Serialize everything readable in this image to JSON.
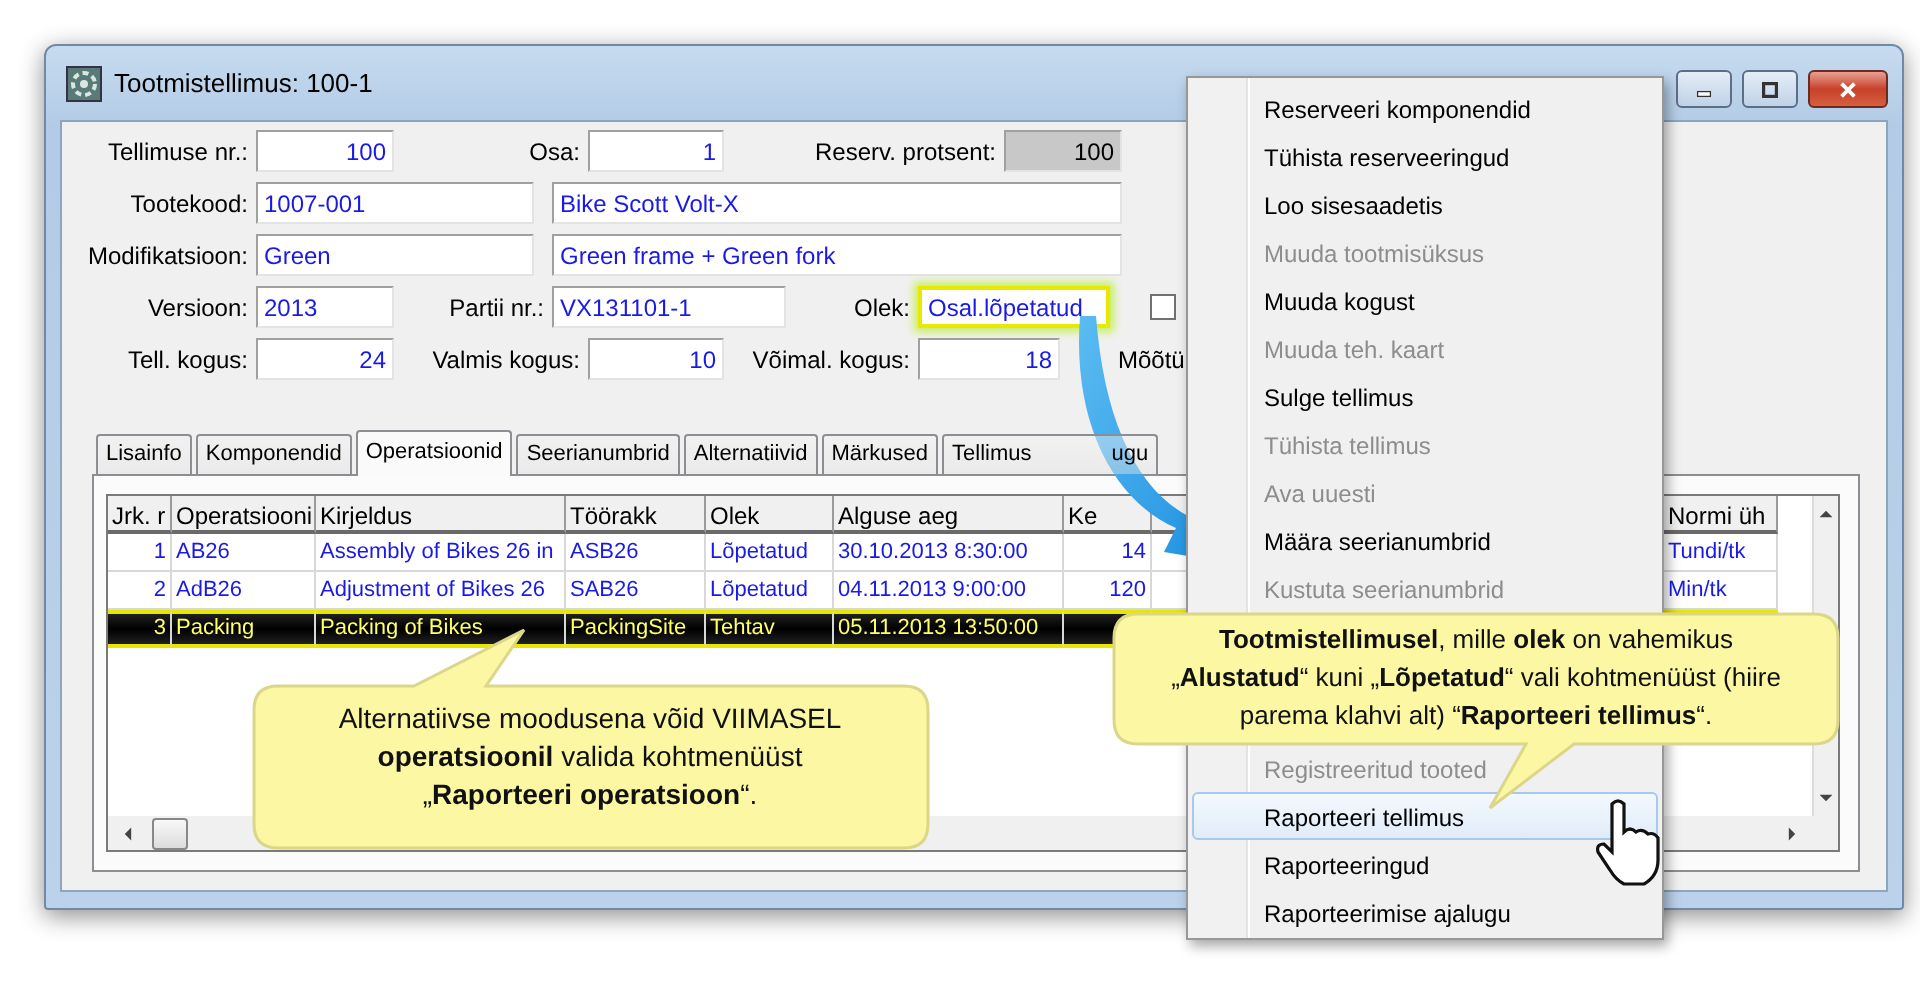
{
  "window": {
    "title": "Tootmistellimus: 100-1"
  },
  "header": {
    "order_no": {
      "label": "Tellimuse nr.:",
      "value": "100"
    },
    "part": {
      "label": "Osa:",
      "value": "1"
    },
    "reserve_percent": {
      "label": "Reserv. protsent:",
      "value": "100",
      "disabled": true
    },
    "product_code": {
      "label": "Tootekood:",
      "value": "1007-001",
      "name": "Bike Scott Volt-X"
    },
    "modification": {
      "label": "Modifikatsioon:",
      "value": "Green",
      "description": "Green frame + Green fork"
    },
    "version": {
      "label": "Versioon:",
      "value": "2013"
    },
    "batch_no": {
      "label": "Partii nr.:",
      "value": "VX131101-1"
    },
    "status": {
      "label": "Olek:",
      "value": "Osal.lõpetatud",
      "highlighted": true
    },
    "checkbox": {
      "checked": false
    },
    "ordered_qty": {
      "label": "Tell. kogus:",
      "value": "24"
    },
    "finished_qty": {
      "label": "Valmis kogus:",
      "value": "10"
    },
    "possible_qty": {
      "label": "Võimal. kogus:",
      "value": "18"
    },
    "unit_label": "Mõõtü"
  },
  "tabs": [
    {
      "label": "Lisainfo",
      "selected": false
    },
    {
      "label": "Komponendid",
      "selected": false
    },
    {
      "label": "Operatsioonid",
      "selected": true
    },
    {
      "label": "Seerianumbrid",
      "selected": false
    },
    {
      "label": "Alternatiivid",
      "selected": false
    },
    {
      "label": "Märkused",
      "selected": false
    },
    {
      "label": "Tellimus",
      "label_end": "ugu",
      "selected": false
    }
  ],
  "table": {
    "columns": [
      "Jrk. r",
      "Operatsiooni",
      "Kirjeldus",
      "Töörakk",
      "Olek",
      "Alguse aeg",
      "Ke",
      "Normi üh"
    ],
    "rows": [
      {
        "cells": [
          "1",
          "AB26",
          "Assembly of Bikes 26 in",
          "ASB26",
          "Lõpetatud",
          "30.10.2013 8:30:00",
          "14",
          "Tundi/tk"
        ],
        "selected": false
      },
      {
        "cells": [
          "2",
          "AdB26",
          "Adjustment of Bikes 26",
          "SAB26",
          "Lõpetatud",
          "04.11.2013 9:00:00",
          "120",
          "Min/tk"
        ],
        "selected": false
      },
      {
        "cells": [
          "3",
          "Packing",
          "Packing of Bikes",
          "PackingSite",
          "Tehtav",
          "05.11.2013 13:50:00"
        ],
        "selected": true
      }
    ]
  },
  "context_menu": {
    "items": [
      {
        "label": "Reserveeri komponendid",
        "disabled": false,
        "selected": false
      },
      {
        "label": "Tühista reserveeringud",
        "disabled": false,
        "selected": false
      },
      {
        "label": "Loo sisesaadetis",
        "disabled": false,
        "selected": false
      },
      {
        "label": "Muuda tootmisüksus",
        "disabled": true,
        "selected": false
      },
      {
        "label": "Muuda kogust",
        "disabled": false,
        "selected": false
      },
      {
        "label": "Muuda teh. kaart",
        "disabled": true,
        "selected": false
      },
      {
        "label": "Sulge tellimus",
        "disabled": false,
        "selected": false
      },
      {
        "label": "Tühista tellimus",
        "disabled": true,
        "selected": false
      },
      {
        "label": "Ava uuesti",
        "disabled": true,
        "selected": false
      },
      {
        "label": "Määra seerianumbrid",
        "disabled": false,
        "selected": false
      },
      {
        "label": "Kustuta seerianumbrid",
        "disabled": true,
        "selected": false
      },
      {
        "kind": "gap"
      },
      {
        "label": "Registreeritud tooted",
        "disabled": true,
        "selected": false
      },
      {
        "label": "Raporteeri tellimus",
        "disabled": false,
        "selected": true
      },
      {
        "label": "Raporteeringud",
        "disabled": false,
        "selected": false
      },
      {
        "label": "Raporteerimise ajalugu",
        "disabled": false,
        "selected": false
      }
    ]
  },
  "callouts": [
    {
      "text": "Alternatiivse moodusena võid VIIMASEL **operatsioonil** valida kohtmenüüst „**Raporteeri operatsioon**“."
    },
    {
      "text": "**Tootmistellimusel**, mille **olek** on vahemikus „**Alustatud**“ kuni „**Lõpetatud**“ vali kohtmenüüst (hiire parema klahvi alt) “**Raporteeri tellimus**“."
    }
  ]
}
